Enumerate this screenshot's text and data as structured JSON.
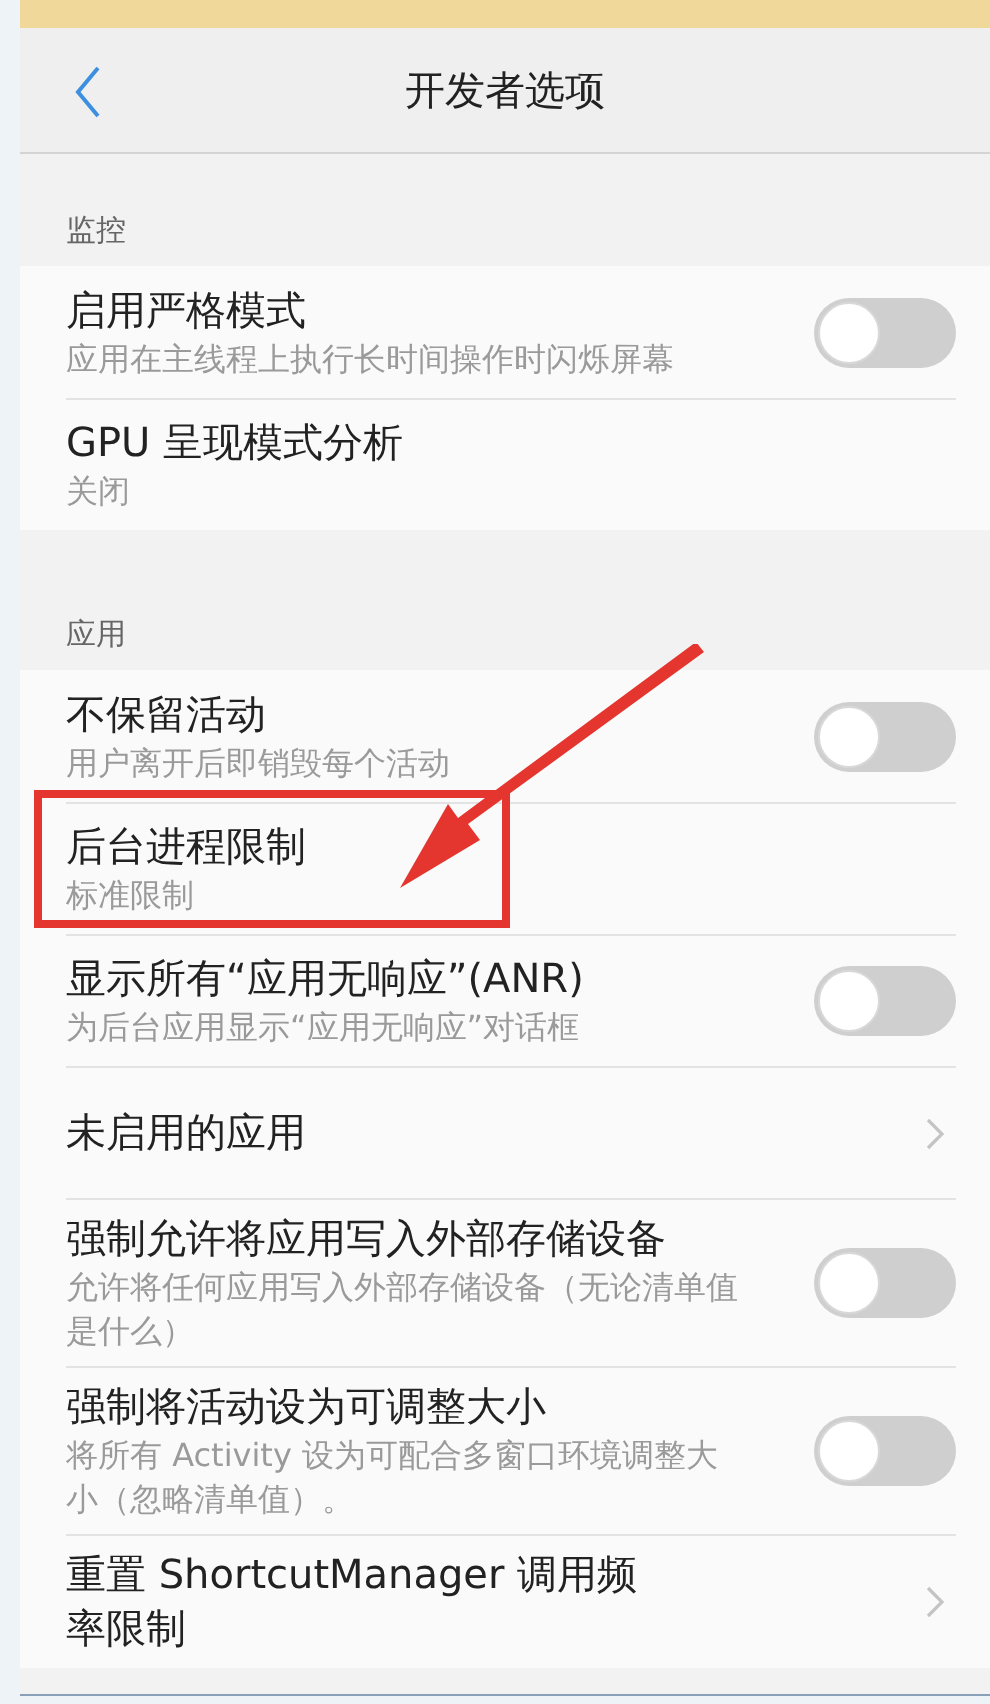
{
  "header": {
    "title": "开发者选项"
  },
  "sections": [
    {
      "label": "监控",
      "items": [
        {
          "kind": "toggle",
          "title": "启用严格模式",
          "subtitle": "应用在主线程上执行长时间操作时闪烁屏幕",
          "on": false
        },
        {
          "kind": "plain",
          "title": "GPU 呈现模式分析",
          "subtitle": "关闭"
        }
      ]
    },
    {
      "label": "应用",
      "items": [
        {
          "kind": "toggle",
          "title": "不保留活动",
          "subtitle": "用户离开后即销毁每个活动",
          "on": false
        },
        {
          "kind": "plain",
          "title": "后台进程限制",
          "subtitle": "标准限制"
        },
        {
          "kind": "toggle",
          "title": "显示所有“应用无响应”(ANR)",
          "subtitle": "为后台应用显示“应用无响应”对话框",
          "on": false
        },
        {
          "kind": "link",
          "title": "未启用的应用"
        },
        {
          "kind": "toggle",
          "title": "强制允许将应用写入外部存储设备",
          "subtitle": "允许将任何应用写入外部存储设备（无论清单值是什么）",
          "on": false
        },
        {
          "kind": "toggle",
          "title": "强制将活动设为可调整大小",
          "subtitle": "将所有 Activity 设为可配合多窗口环境调整大小（忽略清单值）。",
          "on": false
        },
        {
          "kind": "link",
          "title": "重置 ShortcutManager 调用频率限制"
        }
      ]
    }
  ]
}
